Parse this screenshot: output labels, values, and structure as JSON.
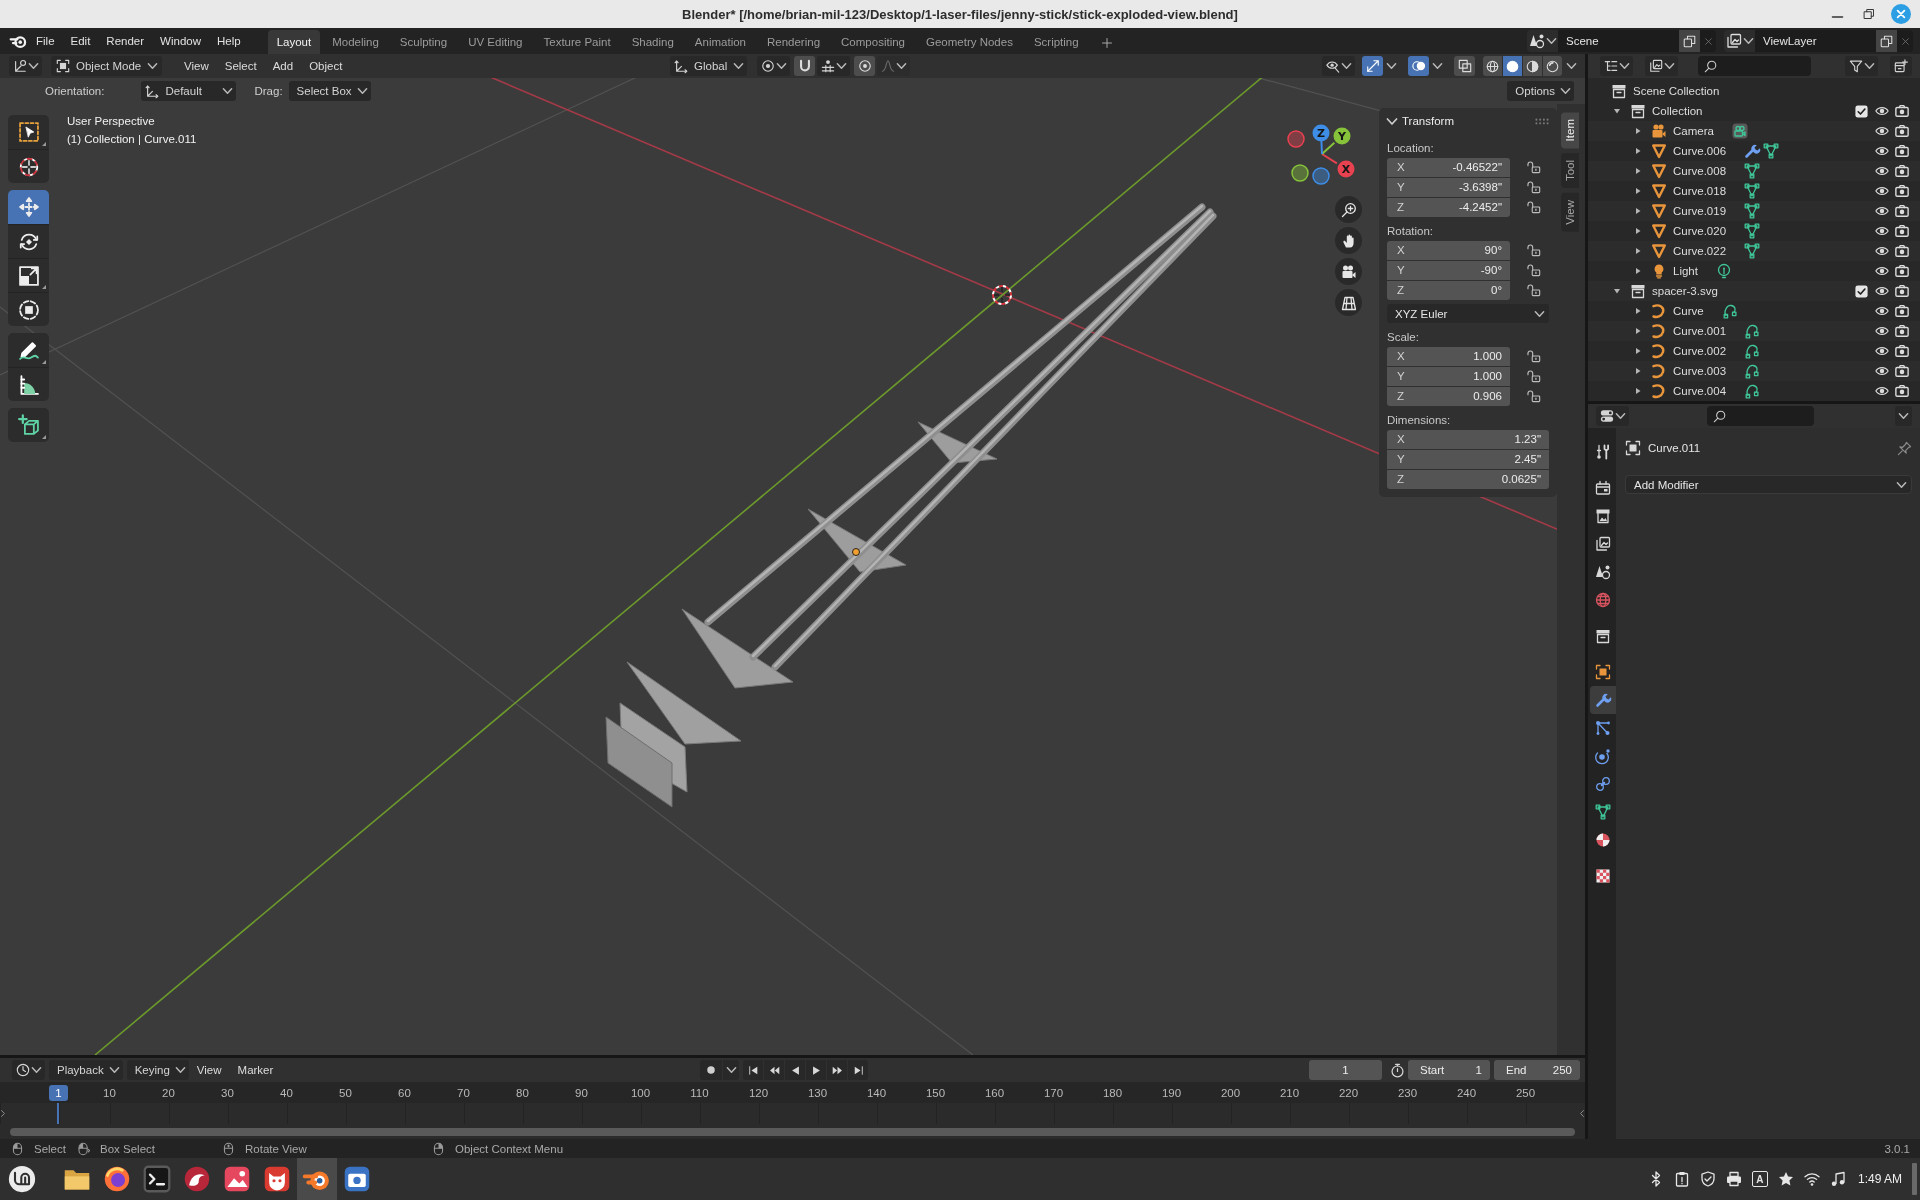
{
  "window": {
    "title": "Blender* [/home/brian-mil-123/Desktop/1-laser-files/jenny-stick/stick-exploded-view.blend]"
  },
  "top_bar": {
    "menus": [
      "File",
      "Edit",
      "Render",
      "Window",
      "Help"
    ],
    "workspaces": [
      {
        "label": "Layout",
        "selected": true
      },
      {
        "label": "Modeling",
        "selected": false
      },
      {
        "label": "Sculpting",
        "selected": false
      },
      {
        "label": "UV Editing",
        "selected": false
      },
      {
        "label": "Texture Paint",
        "selected": false
      },
      {
        "label": "Shading",
        "selected": false
      },
      {
        "label": "Animation",
        "selected": false
      },
      {
        "label": "Rendering",
        "selected": false
      },
      {
        "label": "Compositing",
        "selected": false
      },
      {
        "label": "Geometry Nodes",
        "selected": false
      },
      {
        "label": "Scripting",
        "selected": false
      }
    ],
    "scene": "Scene",
    "view_layer": "ViewLayer"
  },
  "viewport": {
    "header": {
      "mode": "Object Mode",
      "menus": [
        "View",
        "Select",
        "Add",
        "Object"
      ],
      "orientation": "Global",
      "snap_toggles": [
        {
          "kind": "snap",
          "selected": false
        },
        {
          "kind": "proportional",
          "selected": false
        }
      ],
      "display_toggles": [
        {
          "kind": "gizmos",
          "selected": true
        },
        {
          "kind": "overlays",
          "selected": true
        },
        {
          "kind": "xray",
          "selected": false
        }
      ],
      "shading": [
        {
          "kind": "wireframe",
          "selected": false
        },
        {
          "kind": "solid",
          "selected": true
        },
        {
          "kind": "material",
          "selected": false
        },
        {
          "kind": "rendered",
          "selected": false
        }
      ]
    },
    "tool_settings": {
      "orientation_label": "Orientation:",
      "orientation": "Default",
      "drag_label": "Drag:",
      "drag": "Select Box",
      "options": "Options"
    },
    "tools": [
      {
        "kind": "select_box",
        "selected": false,
        "variants": true
      },
      {
        "kind": "cursor",
        "selected": false,
        "variants": false
      },
      {
        "kind": "move",
        "selected": true,
        "variants": false
      },
      {
        "kind": "rotate",
        "selected": false,
        "variants": false
      },
      {
        "kind": "scale",
        "selected": false,
        "variants": true
      },
      {
        "kind": "transform",
        "selected": false,
        "variants": false
      },
      {
        "kind": "annotate",
        "selected": false,
        "variants": true
      },
      {
        "kind": "measure",
        "selected": false,
        "variants": false
      },
      {
        "kind": "add_cube",
        "selected": false,
        "variants": true
      }
    ],
    "view_name": "User Perspective",
    "context": "(1) Collection | Curve.011",
    "gizmo_axes": [
      {
        "label": "X",
        "color": "#e8414f"
      },
      {
        "label": "Y",
        "color": "#86c23a"
      },
      {
        "label": "Z",
        "color": "#3e8ee8"
      }
    ],
    "sidebar": {
      "tabs": [
        {
          "label": "Item",
          "selected": true
        },
        {
          "label": "Tool",
          "selected": false
        },
        {
          "label": "View",
          "selected": false
        }
      ],
      "title": "Transform",
      "groups": [
        {
          "label": "Location:",
          "fields": [
            {
              "axis": "X",
              "value": "-0.46522\"",
              "locked": false
            },
            {
              "axis": "Y",
              "value": "-3.6398\"",
              "locked": false
            },
            {
              "axis": "Z",
              "value": "-4.2452\"",
              "locked": false
            }
          ]
        },
        {
          "label": "Rotation:",
          "fields": [
            {
              "axis": "X",
              "value": "90°",
              "locked": false
            },
            {
              "axis": "Y",
              "value": "-90°",
              "locked": false
            },
            {
              "axis": "Z",
              "value": "0°",
              "locked": false
            }
          ],
          "mode": "XYZ Euler"
        },
        {
          "label": "Scale:",
          "fields": [
            {
              "axis": "X",
              "value": "1.000",
              "locked": false
            },
            {
              "axis": "Y",
              "value": "1.000",
              "locked": false
            },
            {
              "axis": "Z",
              "value": "0.906",
              "locked": false
            }
          ]
        },
        {
          "label": "Dimensions:",
          "fields": [
            {
              "axis": "X",
              "value": "1.23\""
            },
            {
              "axis": "Y",
              "value": "2.45\""
            },
            {
              "axis": "Z",
              "value": "0.0625\""
            }
          ]
        }
      ]
    }
  },
  "outliner": {
    "root": "Scene Collection",
    "items": [
      {
        "name": "Collection",
        "kind": "collection",
        "expanded": true,
        "included": true,
        "visible": true,
        "renderable": true,
        "children": [
          {
            "name": "Camera",
            "kind": "camera",
            "expanded": false,
            "badges": [
              {
                "kind": "camera_data"
              }
            ],
            "visible": true,
            "renderable": true
          },
          {
            "name": "Curve.006",
            "kind": "mesh",
            "expanded": false,
            "badges": [
              {
                "kind": "modifier"
              },
              {
                "kind": "mesh_data"
              }
            ],
            "visible": true,
            "renderable": true
          },
          {
            "name": "Curve.008",
            "kind": "mesh",
            "expanded": false,
            "badges": [
              {
                "kind": "mesh_data"
              }
            ],
            "visible": true,
            "renderable": true
          },
          {
            "name": "Curve.018",
            "kind": "mesh",
            "expanded": false,
            "badges": [
              {
                "kind": "mesh_data"
              }
            ],
            "visible": true,
            "renderable": true
          },
          {
            "name": "Curve.019",
            "kind": "mesh",
            "expanded": false,
            "badges": [
              {
                "kind": "mesh_data"
              }
            ],
            "visible": true,
            "renderable": true
          },
          {
            "name": "Curve.020",
            "kind": "mesh",
            "expanded": false,
            "badges": [
              {
                "kind": "mesh_data"
              }
            ],
            "visible": true,
            "renderable": true
          },
          {
            "name": "Curve.022",
            "kind": "mesh",
            "expanded": false,
            "badges": [
              {
                "kind": "mesh_data"
              }
            ],
            "visible": true,
            "renderable": true
          },
          {
            "name": "Light",
            "kind": "light",
            "expanded": false,
            "badges": [
              {
                "kind": "light_data"
              }
            ],
            "visible": true,
            "renderable": true
          }
        ]
      },
      {
        "name": "spacer-3.svg",
        "kind": "collection",
        "expanded": true,
        "included": true,
        "visible": true,
        "renderable": true,
        "children": [
          {
            "name": "Curve",
            "kind": "curve",
            "expanded": false,
            "badges": [
              {
                "kind": "curve_data"
              }
            ],
            "visible": true,
            "renderable": true
          },
          {
            "name": "Curve.001",
            "kind": "curve",
            "expanded": false,
            "badges": [
              {
                "kind": "curve_data"
              }
            ],
            "visible": true,
            "renderable": true
          },
          {
            "name": "Curve.002",
            "kind": "curve",
            "expanded": false,
            "badges": [
              {
                "kind": "curve_data"
              }
            ],
            "visible": true,
            "renderable": true
          },
          {
            "name": "Curve.003",
            "kind": "curve",
            "expanded": false,
            "badges": [
              {
                "kind": "curve_data"
              }
            ],
            "visible": true,
            "renderable": true
          },
          {
            "name": "Curve.004",
            "kind": "curve",
            "expanded": false,
            "badges": [
              {
                "kind": "curve_data"
              }
            ],
            "visible": true,
            "renderable": true
          }
        ]
      }
    ]
  },
  "properties": {
    "tab_groups": [
      [
        {
          "kind": "tool",
          "selected": false
        }
      ],
      [
        {
          "kind": "render",
          "selected": false
        },
        {
          "kind": "output",
          "selected": false
        },
        {
          "kind": "view_layer",
          "selected": false
        },
        {
          "kind": "scene",
          "selected": false
        },
        {
          "kind": "world",
          "selected": false
        }
      ],
      [
        {
          "kind": "collection",
          "selected": false
        }
      ],
      [
        {
          "kind": "object",
          "selected": false
        },
        {
          "kind": "modifiers",
          "selected": true
        },
        {
          "kind": "particles",
          "selected": false
        },
        {
          "kind": "physics",
          "selected": false
        },
        {
          "kind": "constraints",
          "selected": false
        },
        {
          "kind": "data",
          "selected": false
        },
        {
          "kind": "material",
          "selected": false
        }
      ],
      [
        {
          "kind": "texture",
          "selected": false
        }
      ]
    ],
    "object": "Curve.011",
    "add_modifier": "Add Modifier"
  },
  "timeline": {
    "menus": [
      {
        "label": "Playback",
        "kind": "dropdown"
      },
      {
        "label": "Keying",
        "kind": "dropdown"
      },
      {
        "label": "View",
        "kind": "menu"
      },
      {
        "label": "Marker",
        "kind": "menu"
      }
    ],
    "current_frame": "1",
    "start_label": "Start",
    "start": "1",
    "end_label": "End",
    "end": "250",
    "playhead": "1",
    "ticks": [
      "10",
      "20",
      "30",
      "40",
      "50",
      "60",
      "70",
      "80",
      "90",
      "100",
      "110",
      "120",
      "130",
      "140",
      "150",
      "160",
      "170",
      "180",
      "190",
      "200",
      "210",
      "220",
      "230",
      "240",
      "250"
    ]
  },
  "status_bar": {
    "hints": [
      {
        "kind": "lmb",
        "label": "Select"
      },
      {
        "kind": "lmb_drag",
        "label": "Box Select"
      },
      {
        "kind": "mmb",
        "label": "Rotate View"
      },
      {
        "kind": "rmb",
        "label": "Object Context Menu"
      }
    ],
    "version": "3.0.1"
  },
  "taskbar": {
    "apps": [
      {
        "kind": "files",
        "selected": false
      },
      {
        "kind": "web",
        "selected": false
      },
      {
        "kind": "terminal",
        "selected": false
      },
      {
        "kind": "app_a",
        "selected": false
      },
      {
        "kind": "photos",
        "selected": false
      },
      {
        "kind": "app_b",
        "selected": false
      },
      {
        "kind": "modeler",
        "selected": true
      },
      {
        "kind": "screenshot",
        "selected": false
      }
    ],
    "tray": [
      {
        "kind": "bluetooth"
      },
      {
        "kind": "clipboard"
      },
      {
        "kind": "shield"
      },
      {
        "kind": "printer"
      },
      {
        "kind": "keyboard",
        "label": "A"
      },
      {
        "kind": "star"
      },
      {
        "kind": "wifi"
      },
      {
        "kind": "music"
      }
    ],
    "clock": "1:49 AM"
  }
}
